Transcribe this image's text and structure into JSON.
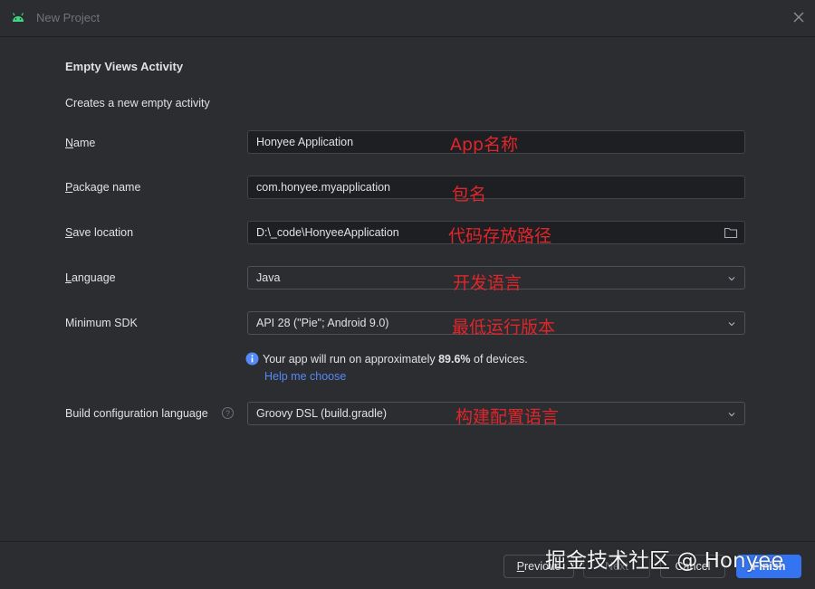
{
  "window": {
    "title": "New Project"
  },
  "page": {
    "heading": "Empty Views Activity",
    "description": "Creates a new empty activity"
  },
  "form": {
    "name": {
      "label_mnemonic": "N",
      "label_rest": "ame",
      "value": "Honyee Application",
      "annotation": "App名称"
    },
    "package": {
      "label_mnemonic": "P",
      "label_rest": "ackage name",
      "value": "com.honyee.myapplication",
      "annotation": "包名"
    },
    "save_location": {
      "label_mnemonic": "S",
      "label_rest": "ave location",
      "value": "D:\\_code\\HonyeeApplication",
      "annotation": "代码存放路径"
    },
    "language": {
      "label_mnemonic": "L",
      "label_rest": "anguage",
      "value": "Java",
      "annotation": "开发语言"
    },
    "min_sdk": {
      "label": "Minimum SDK",
      "value": "API 28 (\"Pie\"; Android 9.0)",
      "annotation": "最低运行版本"
    },
    "info": {
      "prefix": "Your app will run on approximately ",
      "percent": "89.6%",
      "suffix": " of devices.",
      "link": "Help me choose"
    },
    "build_config": {
      "label": "Build configuration language",
      "help_mark": "?",
      "value": "Groovy DSL (build.gradle)",
      "annotation": "构建配置语言"
    }
  },
  "footer": {
    "previous_mnemonic": "P",
    "previous_rest": "revious",
    "next": "Next",
    "cancel": "Cancel",
    "finish": "Finish"
  },
  "watermark": "掘金技术社区 @ Honyee",
  "colors": {
    "accent": "#3574f0",
    "link": "#548af7",
    "annotation": "#e0262a",
    "background": "#2b2d30",
    "field": "#1e1f22"
  },
  "icons": {
    "app": "android-icon",
    "close": "close-icon",
    "folder": "folder-icon",
    "dropdown": "chevron-down-icon",
    "info": "info-icon",
    "help": "help-icon"
  }
}
